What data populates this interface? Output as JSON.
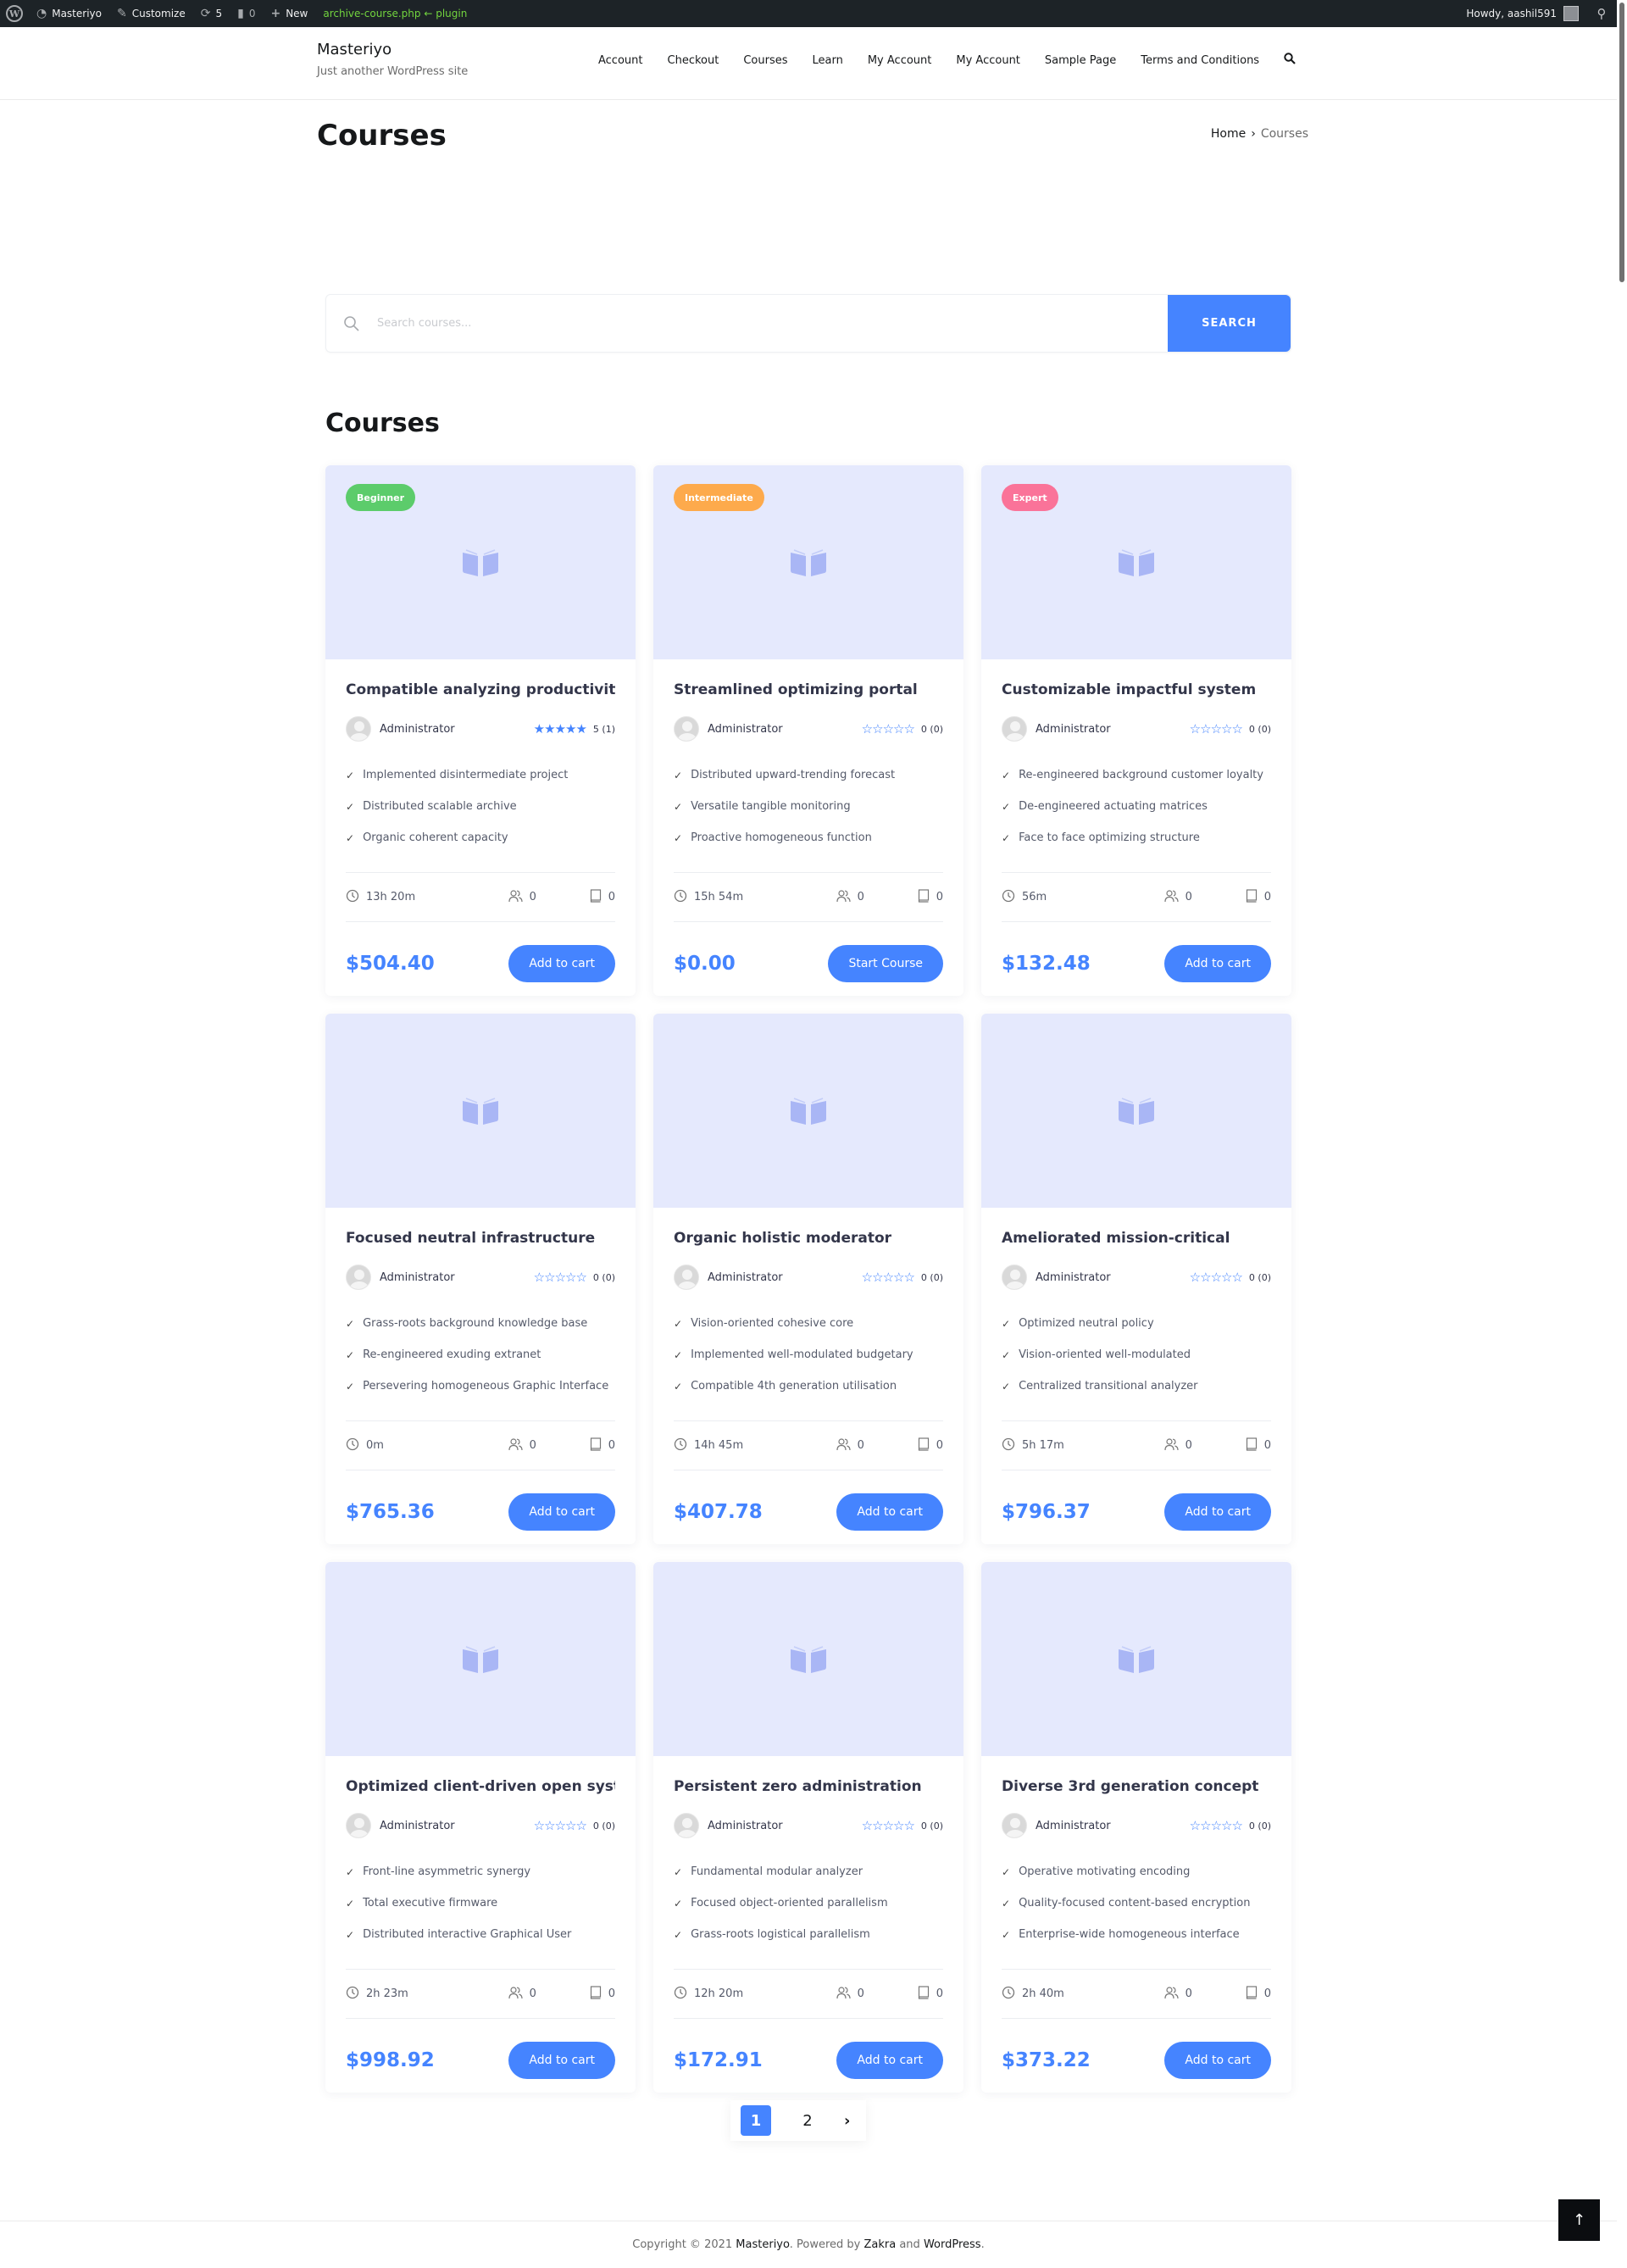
{
  "adminbar": {
    "site_name": "Masteriyo",
    "customize": "Customize",
    "updates_count": "5",
    "comments_count": "0",
    "new_label": "New",
    "template_info": "archive-course.php ← plugin",
    "howdy": "Howdy, aashil591"
  },
  "header": {
    "site_title": "Masteriyo",
    "tagline": "Just another WordPress site",
    "nav": [
      "Account",
      "Checkout",
      "Courses",
      "Learn",
      "My Account",
      "My Account",
      "Sample Page",
      "Terms and Conditions"
    ]
  },
  "page": {
    "title": "Courses",
    "breadcrumb": {
      "home": "Home",
      "separator": "›",
      "current": "Courses"
    }
  },
  "search": {
    "placeholder": "Search courses...",
    "value": "",
    "button_label": "SEARCH"
  },
  "section_title": "Courses",
  "colors": {
    "accent": "#4584ff",
    "beginner": "#5ccc6b",
    "intermediate": "#fdaa4c",
    "expert": "#fa7399",
    "thumb_bg": "#e5e9fd"
  },
  "courses": [
    {
      "badge": "Beginner",
      "badge_color": "#5ccc6b",
      "title": "Compatible analyzing productivity",
      "author": "Administrator",
      "rating": 5,
      "rating_text": "5 (1)",
      "highlights": [
        "Implemented disintermediate project",
        "Distributed scalable archive",
        "Organic coherent capacity"
      ],
      "duration": "13h 20m",
      "students": "0",
      "lessons": "0",
      "price": "$504.40",
      "cta": "Add to cart"
    },
    {
      "badge": "Intermediate",
      "badge_color": "#fdaa4c",
      "title": "Streamlined optimizing portal",
      "author": "Administrator",
      "rating": 0,
      "rating_text": "0 (0)",
      "highlights": [
        "Distributed upward-trending forecast",
        "Versatile tangible monitoring",
        "Proactive homogeneous function"
      ],
      "duration": "15h 54m",
      "students": "0",
      "lessons": "0",
      "price": "$0.00",
      "cta": "Start Course"
    },
    {
      "badge": "Expert",
      "badge_color": "#fa7399",
      "title": "Customizable impactful system",
      "author": "Administrator",
      "rating": 0,
      "rating_text": "0 (0)",
      "highlights": [
        "Re-engineered background customer loyalty",
        "De-engineered actuating matrices",
        "Face to face optimizing structure"
      ],
      "duration": "56m",
      "students": "0",
      "lessons": "0",
      "price": "$132.48",
      "cta": "Add to cart"
    },
    {
      "badge": "",
      "badge_color": "",
      "title": "Focused neutral infrastructure",
      "author": "Administrator",
      "rating": 0,
      "rating_text": "0 (0)",
      "highlights": [
        "Grass-roots background knowledge base",
        "Re-engineered exuding extranet",
        "Persevering homogeneous Graphic Interface"
      ],
      "duration": "0m",
      "students": "0",
      "lessons": "0",
      "price": "$765.36",
      "cta": "Add to cart"
    },
    {
      "badge": "",
      "badge_color": "",
      "title": "Organic holistic moderator",
      "author": "Administrator",
      "rating": 0,
      "rating_text": "0 (0)",
      "highlights": [
        "Vision-oriented cohesive core",
        "Implemented well-modulated budgetary",
        "Compatible 4th generation utilisation"
      ],
      "duration": "14h 45m",
      "students": "0",
      "lessons": "0",
      "price": "$407.78",
      "cta": "Add to cart"
    },
    {
      "badge": "",
      "badge_color": "",
      "title": "Ameliorated mission-critical",
      "author": "Administrator",
      "rating": 0,
      "rating_text": "0 (0)",
      "highlights": [
        "Optimized neutral policy",
        "Vision-oriented well-modulated",
        "Centralized transitional analyzer"
      ],
      "duration": "5h 17m",
      "students": "0",
      "lessons": "0",
      "price": "$796.37",
      "cta": "Add to cart"
    },
    {
      "badge": "",
      "badge_color": "",
      "title": "Optimized client-driven open system",
      "author": "Administrator",
      "rating": 0,
      "rating_text": "0 (0)",
      "highlights": [
        "Front-line asymmetric synergy",
        "Total executive firmware",
        "Distributed interactive Graphical User"
      ],
      "duration": "2h 23m",
      "students": "0",
      "lessons": "0",
      "price": "$998.92",
      "cta": "Add to cart"
    },
    {
      "badge": "",
      "badge_color": "",
      "title": "Persistent zero administration",
      "author": "Administrator",
      "rating": 0,
      "rating_text": "0 (0)",
      "highlights": [
        "Fundamental modular analyzer",
        "Focused object-oriented parallelism",
        "Grass-roots logistical parallelism"
      ],
      "duration": "12h 20m",
      "students": "0",
      "lessons": "0",
      "price": "$172.91",
      "cta": "Add to cart"
    },
    {
      "badge": "",
      "badge_color": "",
      "title": "Diverse 3rd generation concept",
      "author": "Administrator",
      "rating": 0,
      "rating_text": "0 (0)",
      "highlights": [
        "Operative motivating encoding",
        "Quality-focused content-based encryption",
        "Enterprise-wide homogeneous interface"
      ],
      "duration": "2h 40m",
      "students": "0",
      "lessons": "0",
      "price": "$373.22",
      "cta": "Add to cart"
    }
  ],
  "pagination": {
    "pages": [
      "1",
      "2"
    ],
    "current": "1",
    "next": "›"
  },
  "footer": {
    "prefix": "Copyright © 2021 ",
    "site_link": "Masteriyo",
    "mid": ". Powered by ",
    "theme_link": "Zakra",
    "and": " and ",
    "wp_link": "WordPress",
    "suffix": "."
  },
  "back_to_top": "↑"
}
